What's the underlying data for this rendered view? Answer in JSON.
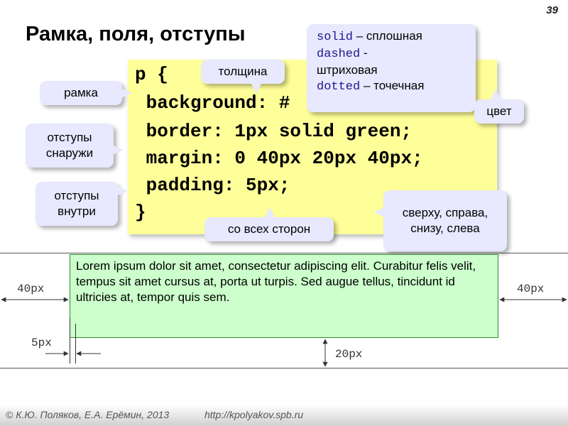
{
  "slide_number": "39",
  "title": "Рамка, поля, отступы",
  "code": {
    "line1": "p {",
    "line2": " background: #",
    "line3": " border: 1px solid green;",
    "line4": " margin: 0 40px 20px 40px;",
    "line5": " padding: 5px;",
    "line6": "}"
  },
  "callouts": {
    "ramka": "рамка",
    "tolshchina": "толщина",
    "otstupy_snaruzhi_1": "отступы",
    "otstupy_snaruzhi_2": "снаружи",
    "otstupy_vnutri_1": "отступы",
    "otstupy_vnutri_2": "внутри",
    "so_vsekh_storon": "со всех сторон",
    "tsvet": "цвет",
    "order_1": "сверху, справа,",
    "order_2": "снизу, слева",
    "styles": {
      "solid_kw": "solid",
      "solid_desc": " – сплошная",
      "dashed_kw": "dashed",
      "dashed_desc": " -",
      "dashed_desc2": "штриховая",
      "dotted_kw": "dotted",
      "dotted_desc": " – точечная"
    }
  },
  "demo": {
    "paragraph": "Lorem ipsum dolor sit amet, consectetur adipiscing elit. Curabitur felis velit, tempus sit amet cursus at, porta ut turpis. Sed augue tellus, tincidunt id ultricies at, tempor quis sem.",
    "label_left_margin": "40px",
    "label_right_margin": "40px",
    "label_padding": "5px",
    "label_bottom_margin": "20px"
  },
  "footer": {
    "authors": "© К.Ю. Поляков, Е.А. Ерёмин, 2013",
    "url": "http://kpolyakov.spb.ru"
  },
  "colors": {
    "code_bg": "#ffff99",
    "bubble_bg": "#e8e8ff",
    "paragraph_bg": "#ccffcc",
    "paragraph_border": "#2e8b2e"
  }
}
